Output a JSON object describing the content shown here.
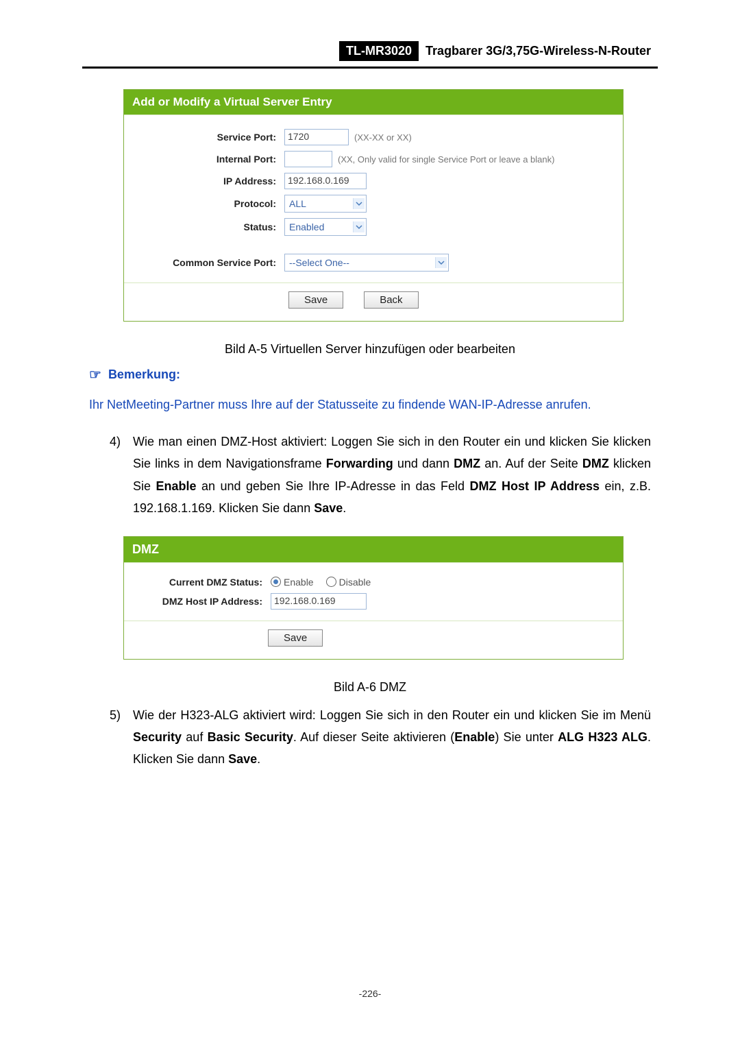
{
  "header": {
    "model": "TL-MR3020",
    "tagline": "Tragbarer 3G/3,75G-Wireless-N-Router"
  },
  "panel1": {
    "title": "Add or Modify a Virtual Server Entry",
    "rows": {
      "service_port_label": "Service Port:",
      "service_port_value": "1720",
      "service_port_hint": "(XX-XX or XX)",
      "internal_port_label": "Internal Port:",
      "internal_port_value": "",
      "internal_port_hint": "(XX, Only valid for single Service Port or leave a blank)",
      "ip_label": "IP Address:",
      "ip_value": "192.168.0.169",
      "protocol_label": "Protocol:",
      "protocol_value": "ALL",
      "status_label": "Status:",
      "status_value": "Enabled",
      "csp_label": "Common Service Port:",
      "csp_value": "--Select One--"
    },
    "buttons": {
      "save": "Save",
      "back": "Back"
    }
  },
  "caption1": "Bild A-5 Virtuellen Server hinzufügen oder bearbeiten",
  "note": {
    "heading": "Bemerkung:",
    "text": "Ihr NetMeeting-Partner muss Ihre auf der Statusseite zu findende WAN-IP-Adresse anrufen."
  },
  "item4": {
    "num": "4)",
    "pre": "Wie man einen DMZ-Host aktiviert: Loggen Sie sich in den Router ein und klicken Sie klicken Sie links in dem Navigationsframe ",
    "b1": "Forwarding",
    "mid1": " und dann ",
    "b2": "DMZ",
    "mid2": " an. Auf der Seite ",
    "b3": "DMZ",
    "mid3": " klicken Sie ",
    "b4": "Enable",
    "mid4": " an und geben Sie Ihre IP-Adresse in das Feld ",
    "b5": "DMZ Host IP Address",
    "mid5": " ein, z.B. 192.168.1.169. Klicken Sie dann ",
    "b6": "Save",
    "mid6": "."
  },
  "panel2": {
    "title": "DMZ",
    "status_label": "Current DMZ Status:",
    "enable": "Enable",
    "disable": "Disable",
    "ip_label": "DMZ Host IP Address:",
    "ip_value": "192.168.0.169",
    "save": "Save"
  },
  "caption2": "Bild A-6 DMZ",
  "item5": {
    "num": "5)",
    "pre": "Wie der H323-ALG aktiviert wird: Loggen Sie sich in den Router ein und klicken Sie im Menü ",
    "b1": "Security",
    "mid1": " auf ",
    "b2": "Basic Security",
    "mid2": ". Auf dieser Seite aktivieren (",
    "b3": "Enable",
    "mid3": ") Sie unter ",
    "b4": "ALG H323 ALG",
    "mid4": ". Klicken Sie dann ",
    "b5": "Save",
    "mid5": "."
  },
  "pagenum": "-226-"
}
